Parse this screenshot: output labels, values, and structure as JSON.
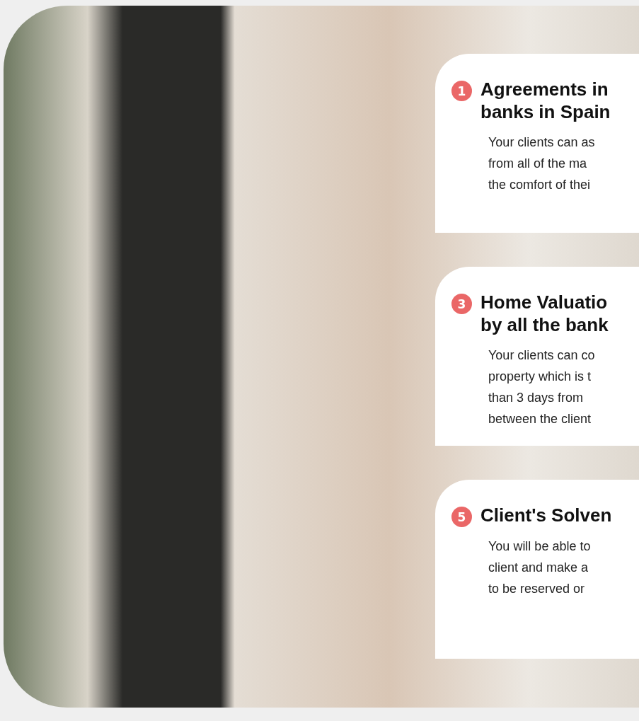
{
  "cards": [
    {
      "number": "1",
      "title_lines": [
        "Agreements in",
        "banks in Spain"
      ],
      "body_lines": [
        "Your clients can as",
        "from all of the ma",
        "the comfort of thei"
      ]
    },
    {
      "number": "3",
      "title_lines": [
        "Home Valuatio",
        "by all the bank"
      ],
      "body_lines": [
        "Your clients can co",
        "property which is t",
        "than 3 days from",
        "between the client"
      ]
    },
    {
      "number": "5",
      "title_lines": [
        "Client's Solven"
      ],
      "body_lines": [
        "You will be able to",
        "client and make a",
        "to be reserved or"
      ]
    }
  ]
}
